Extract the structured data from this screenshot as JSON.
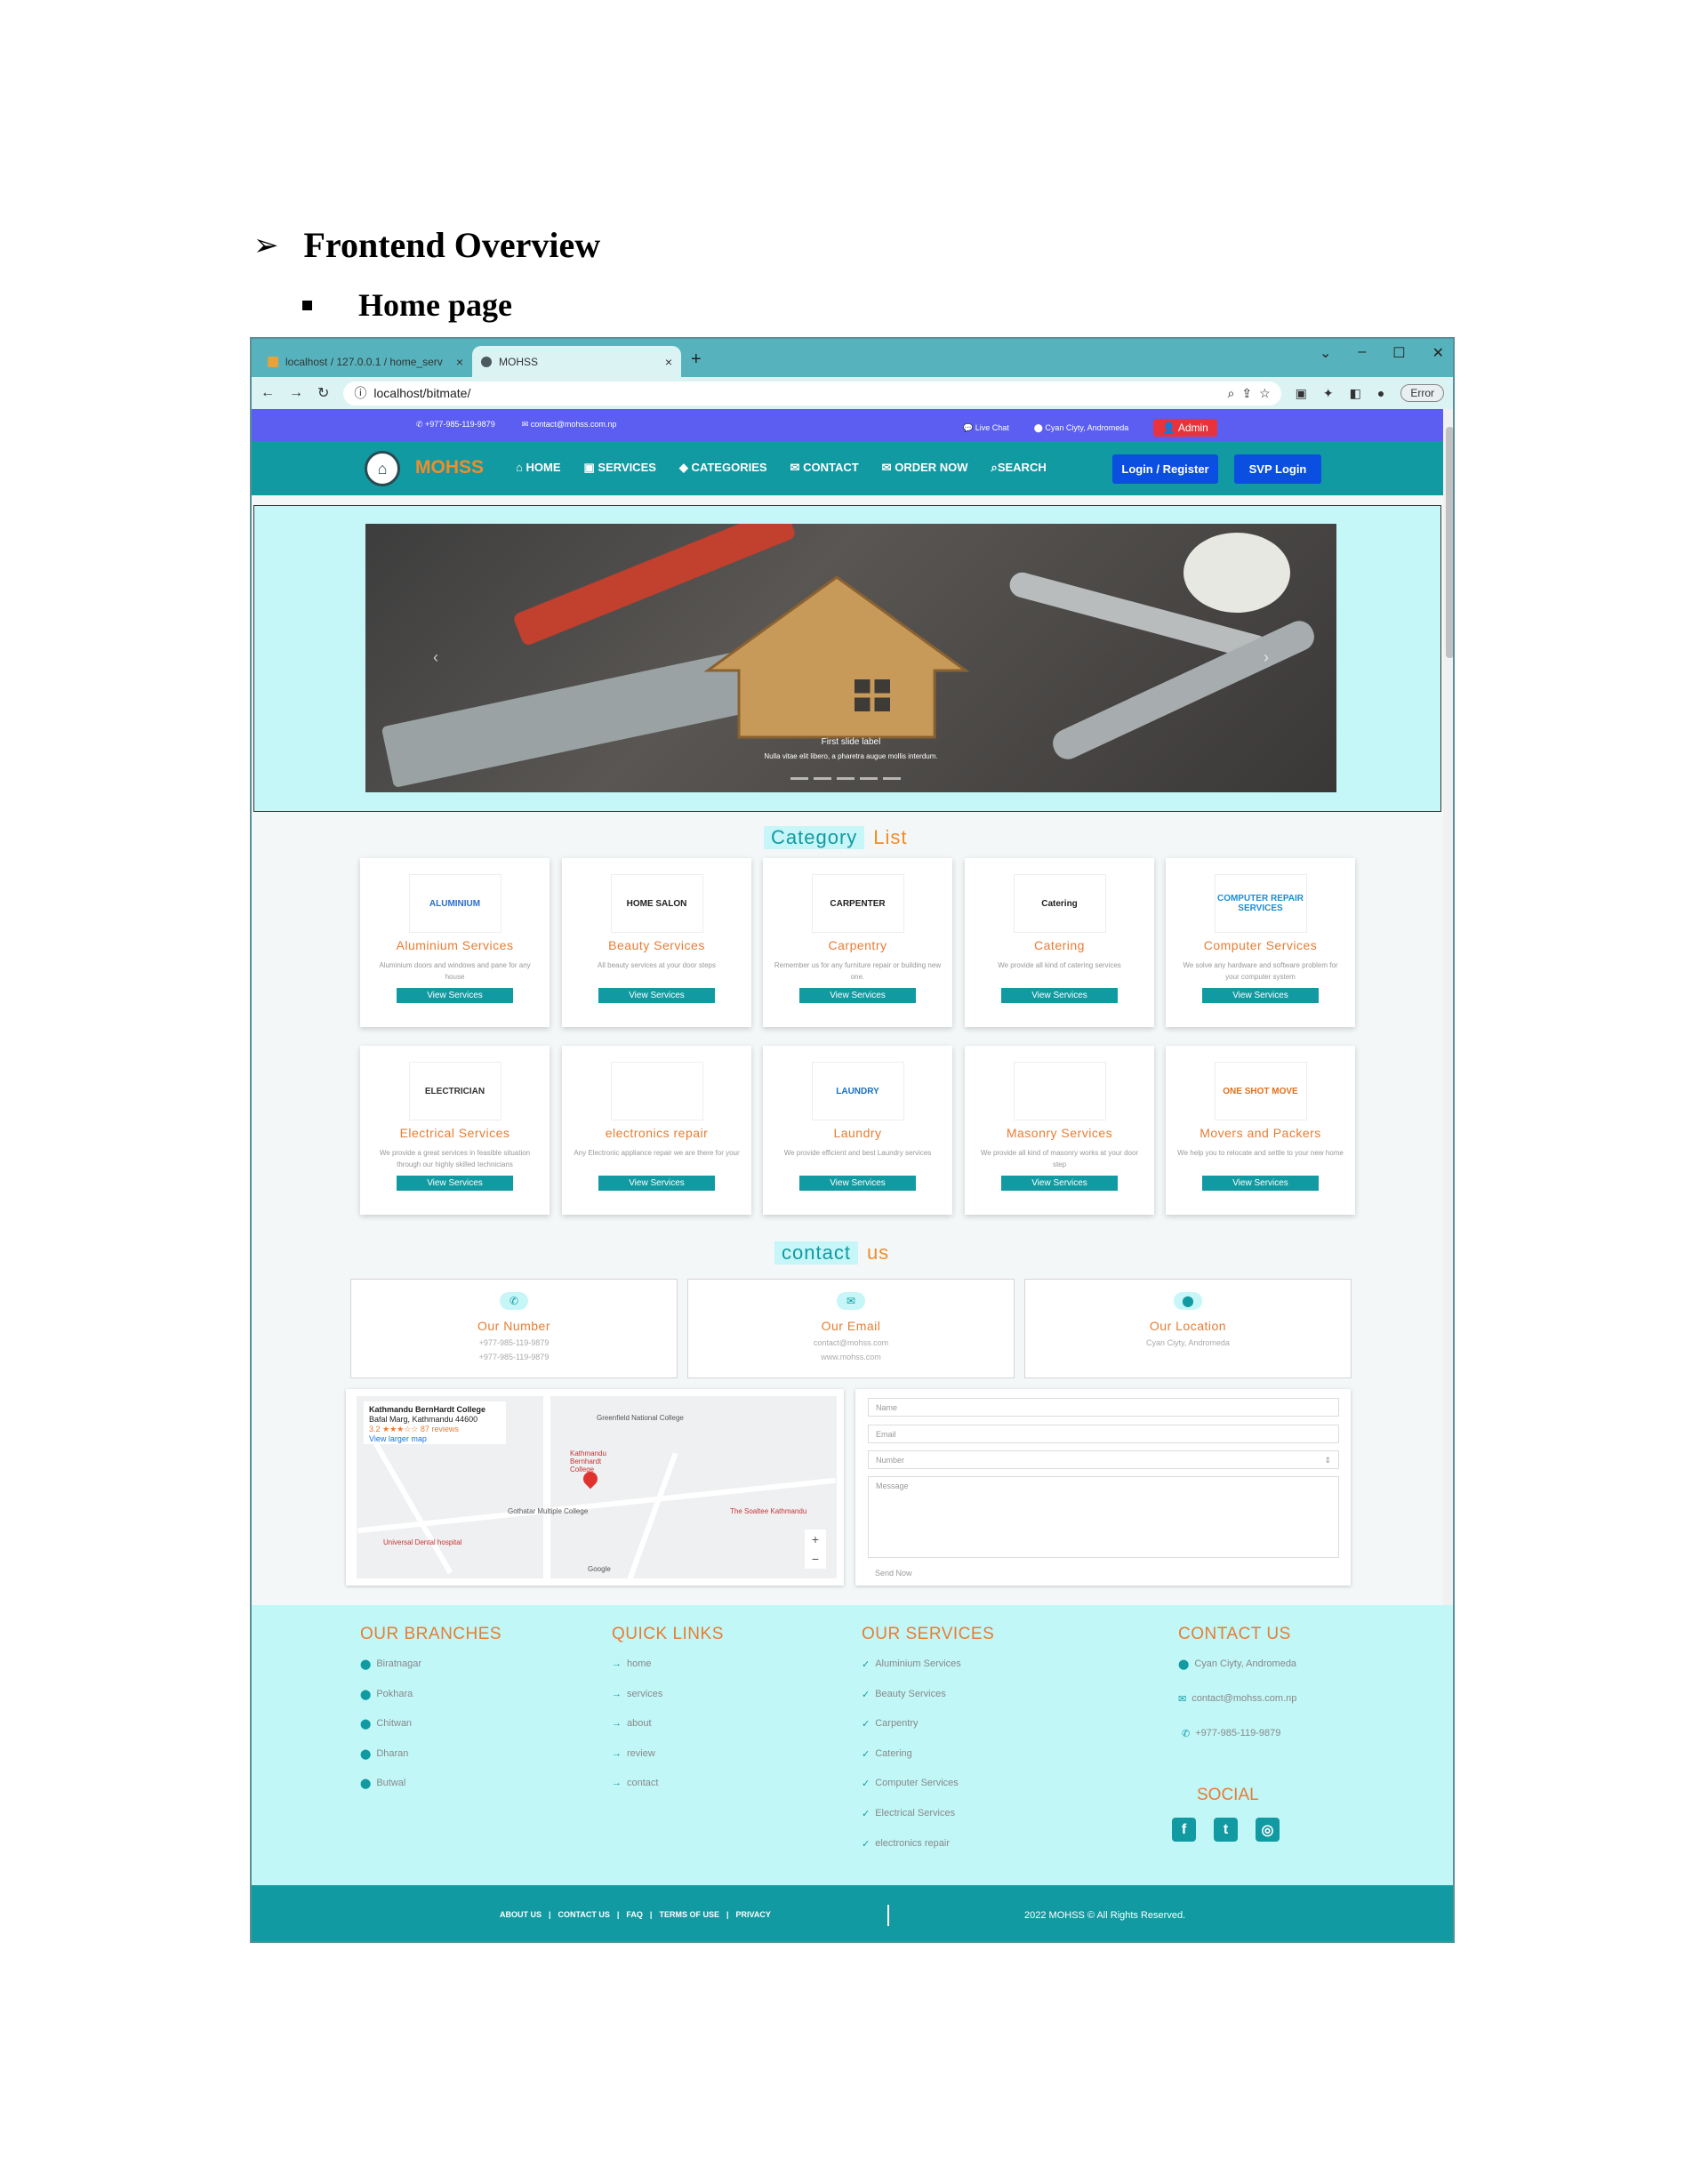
{
  "doc": {
    "heading": "Frontend Overview",
    "subheading": "Home page"
  },
  "browser": {
    "tabs": [
      {
        "label": "localhost / 127.0.0.1 / home_serv"
      },
      {
        "label": "MOHSS"
      }
    ],
    "new_tab": "+",
    "url": "localhost/bitmate/",
    "error_label": "Error"
  },
  "topbar": {
    "phone": "+977-985-119-9879",
    "email": "contact@mohss.com.np",
    "live_chat": "Live Chat",
    "location": "Cyan Ciyty, Andromeda",
    "admin": "Admin"
  },
  "nav": {
    "brand": "MOHSS",
    "links": [
      "HOME",
      "SERVICES",
      "CATEGORIES",
      "CONTACT",
      "ORDER NOW",
      "SEARCH"
    ],
    "login": "Login / Register",
    "svp_login": "SVP Login"
  },
  "hero": {
    "caption_title": "First slide label",
    "caption_text": "Nulla vitae elit libero, a pharetra augue mollis interdum."
  },
  "category_section": {
    "title_a": "Category",
    "title_b": "List"
  },
  "categories": [
    {
      "name": "Aluminium Services",
      "desc": "Aluminium doors and windows and pane for any house",
      "button": "View Services",
      "logo_text": "ALUMINIUM",
      "icon": "aluminium-logo-icon",
      "color": "#2b6cd0"
    },
    {
      "name": "Beauty Services",
      "desc": "All beauty services at your door steps",
      "button": "View Services",
      "logo_text": "HOME SALON",
      "icon": "salon-logo-icon",
      "color": "#222222"
    },
    {
      "name": "Carpentry",
      "desc": "Remember us for any furniture repair or building new one.",
      "button": "View Services",
      "logo_text": "CARPENTER",
      "icon": "carpenter-logo-icon",
      "color": "#222222"
    },
    {
      "name": "Catering",
      "desc": "We provide all kind of catering services",
      "button": "View Services",
      "logo_text": "Catering",
      "icon": "catering-logo-icon",
      "color": "#222222"
    },
    {
      "name": "Computer Services",
      "desc": "We solve any hardware and software problem for your computer system",
      "button": "View Services",
      "logo_text": "COMPUTER REPAIR SERVICES",
      "icon": "computer-logo-icon",
      "color": "#1a8ed8"
    },
    {
      "name": "Electrical Services",
      "desc": "We provide a great services in feasible situation through our highly skilled technicians",
      "button": "View Services",
      "logo_text": "ELECTRICIAN",
      "icon": "electrician-logo-icon",
      "color": "#333333"
    },
    {
      "name": "electronics repair",
      "desc": "Any Electronic appliance repair we are there for your",
      "button": "View Services",
      "logo_text": "",
      "icon": "electronics-logo-icon",
      "color": "#333333"
    },
    {
      "name": "Laundry",
      "desc": "We provide efficient and best Laundry services",
      "button": "View Services",
      "logo_text": "LAUNDRY",
      "icon": "laundry-logo-icon",
      "color": "#1a6fc4"
    },
    {
      "name": "Masonry Services",
      "desc": "We provide all kind of masonry works at your door step",
      "button": "View Services",
      "logo_text": "",
      "icon": "masonry-logo-icon",
      "color": "#111111"
    },
    {
      "name": "Movers and Packers",
      "desc": "We help you to relocate and settle to your new home",
      "button": "View Services",
      "logo_text": "ONE SHOT MOVE",
      "icon": "movers-logo-icon",
      "color": "#e0701e"
    }
  ],
  "contact_section": {
    "title_a": "contact",
    "title_b": "us"
  },
  "contact_cards": [
    {
      "title": "Our Number",
      "lines": [
        "+977-985-119-9879",
        "+977-985-119-9879"
      ],
      "icon": "phone-icon"
    },
    {
      "title": "Our Email",
      "lines": [
        "contact@mohss.com",
        "www.mohss.com"
      ],
      "icon": "envelope-icon"
    },
    {
      "title": "Our Location",
      "lines": [
        "Cyan Ciyty, Andromeda"
      ],
      "icon": "map-pin-icon"
    }
  ],
  "map": {
    "place": "Kathmandu BernHardt College",
    "address": "Bafal Marg, Kathmandu 44600",
    "rating": "3.2 ★★★☆☆ 87 reviews",
    "view_larger": "View larger map",
    "labels": [
      "Greenfield National College",
      "Kathmandu Bernhardt College",
      "Gothatar Multiple College",
      "The Soaltee Kathmandu",
      "Universal Dental hospital",
      "Google"
    ]
  },
  "form": {
    "name": "Name",
    "email": "Email",
    "number": "Number",
    "message": "Message",
    "submit": "Send Now"
  },
  "footer": {
    "branches_title": "OUR BRANCHES",
    "branches": [
      "Biratnagar",
      "Pokhara",
      "Chitwan",
      "Dharan",
      "Butwal"
    ],
    "links_title": "QUICK LINKS",
    "links": [
      "home",
      "services",
      "about",
      "review",
      "contact"
    ],
    "services_title": "OUR SERVICES",
    "services": [
      "Aluminium Services",
      "Beauty Services",
      "Carpentry",
      "Catering",
      "Computer Services",
      "Electrical Services",
      "electronics repair"
    ],
    "contact_title": "CONTACT US",
    "contact": [
      "Cyan Ciyty, Andromeda",
      "contact@mohss.com.np",
      "+977-985-119-9879"
    ],
    "social_title": "SOCIAL",
    "bottom_links": [
      "ABOUT US",
      "CONTACT US",
      "FAQ",
      "TERMS OF USE",
      "PRIVACY"
    ],
    "copyright": "2022 MOHSS © All Rights Reserved."
  }
}
